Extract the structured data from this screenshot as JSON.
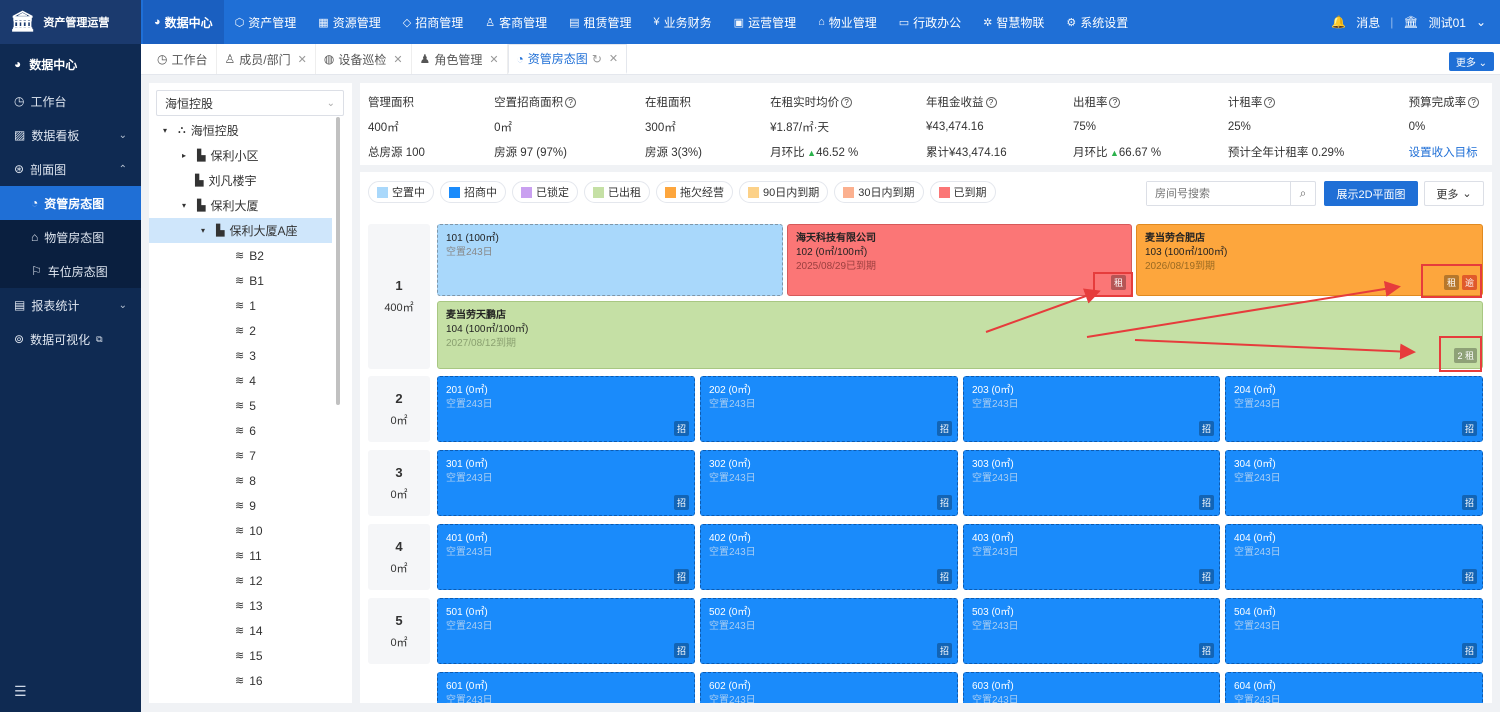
{
  "app": {
    "title": "资产管理运营"
  },
  "nav": [
    {
      "label": "数据中心",
      "icon": "pie-chart-icon",
      "glyph": "◕",
      "active": true
    },
    {
      "label": "资产管理",
      "icon": "cube-icon",
      "glyph": "⬡"
    },
    {
      "label": "资源管理",
      "icon": "building-icon",
      "glyph": "▦"
    },
    {
      "label": "招商管理",
      "icon": "tag-icon",
      "glyph": "◇"
    },
    {
      "label": "客商管理",
      "icon": "users-icon",
      "glyph": "♙"
    },
    {
      "label": "租赁管理",
      "icon": "file-icon",
      "glyph": "▤"
    },
    {
      "label": "业务财务",
      "icon": "yen-icon",
      "glyph": "¥"
    },
    {
      "label": "运营管理",
      "icon": "monitor-icon",
      "glyph": "▣"
    },
    {
      "label": "物业管理",
      "icon": "home-icon",
      "glyph": "⌂"
    },
    {
      "label": "行政办公",
      "icon": "desk-icon",
      "glyph": "▭"
    },
    {
      "label": "智慧物联",
      "icon": "iot-icon",
      "glyph": "✲"
    },
    {
      "label": "系统设置",
      "icon": "gear-icon",
      "glyph": "⚙"
    }
  ],
  "header_right": {
    "messages": "消息",
    "user": "测试01"
  },
  "sidebar": {
    "head": "数据中心",
    "items": [
      {
        "label": "工作台"
      },
      {
        "label": "数据看板"
      },
      {
        "label": "剖面图"
      },
      {
        "label": "报表统计"
      },
      {
        "label": "数据可视化"
      }
    ],
    "subitems": [
      {
        "label": "资管房态图"
      },
      {
        "label": "物管房态图"
      },
      {
        "label": "车位房态图"
      }
    ]
  },
  "tabs": [
    {
      "label": "工作台"
    },
    {
      "label": "成员/部门"
    },
    {
      "label": "设备巡检"
    },
    {
      "label": "角色管理"
    },
    {
      "label": "资管房态图"
    }
  ],
  "tabs_more": "更多",
  "tree": {
    "selector": "海恒控股",
    "nodes": [
      "海恒控股",
      "保利小区",
      "刘凡楼宇",
      "保利大厦",
      "保利大厦A座",
      "B2",
      "B1",
      "1",
      "2",
      "3",
      "4",
      "5",
      "6",
      "7",
      "8",
      "9",
      "10",
      "11",
      "12",
      "13",
      "14",
      "15",
      "16"
    ]
  },
  "stats": {
    "headers": [
      "管理面积",
      "空置招商面积",
      "在租面积",
      "在租实时均价",
      "年租金收益",
      "出租率",
      "计租率",
      "预算完成率"
    ],
    "values": [
      "400㎡",
      "0㎡",
      "300㎡",
      "¥1.87/㎡·天",
      "¥43,474.16",
      "75%",
      "25%",
      "0%"
    ],
    "row3": [
      "总房源 100",
      "房源 97 (97%)",
      "房源 3(3%)",
      "月环比",
      "累计¥43,474.16",
      "月环比",
      "预计全年计租率 0.29%",
      "设置收入目标"
    ],
    "mom1": "46.52 %",
    "mom2": "66.67 %"
  },
  "legend": [
    {
      "label": "空置中",
      "color": "#a9d8fb"
    },
    {
      "label": "招商中",
      "color": "#1a8bfb"
    },
    {
      "label": "已锁定",
      "color": "#c9a0f0"
    },
    {
      "label": "已出租",
      "color": "#c5e0a5"
    },
    {
      "label": "拖欠经营",
      "color": "#fda63d"
    },
    {
      "label": "90日内到期",
      "color": "#fcd188"
    },
    {
      "label": "30日内到期",
      "color": "#fbb08f"
    },
    {
      "label": "已到期",
      "color": "#fb7676"
    }
  ],
  "toolbar": {
    "search_placeholder": "房间号搜索",
    "show2d": "展示2D平面图",
    "more": "更多"
  },
  "floors": [
    {
      "num": "1",
      "area": "400㎡"
    },
    {
      "num": "2",
      "area": "0㎡"
    },
    {
      "num": "3",
      "area": "0㎡"
    },
    {
      "num": "4",
      "area": "0㎡"
    },
    {
      "num": "5",
      "area": "0㎡"
    }
  ],
  "rooms": {
    "r101": {
      "name": "101 (100㎡)",
      "status": "空置243日"
    },
    "r102": {
      "tenant": "海天科技有限公司",
      "name": "102 (0㎡/100㎡)",
      "status": "2025/08/29已到期",
      "badge": "租"
    },
    "r103": {
      "tenant": "麦当劳合肥店",
      "name": "103 (100㎡/100㎡)",
      "status": "2026/08/19到期",
      "badge1": "租",
      "badge2": "逾"
    },
    "r104": {
      "tenant": "麦当劳天鹏店",
      "name": "104 (100㎡/100㎡)",
      "status": "2027/08/12到期",
      "badge": "2 租"
    },
    "grid": [
      [
        "201 (0㎡)",
        "202 (0㎡)",
        "203 (0㎡)",
        "204 (0㎡)"
      ],
      [
        "301 (0㎡)",
        "302 (0㎡)",
        "303 (0㎡)",
        "304 (0㎡)"
      ],
      [
        "401 (0㎡)",
        "402 (0㎡)",
        "403 (0㎡)",
        "404 (0㎡)"
      ],
      [
        "501 (0㎡)",
        "502 (0㎡)",
        "503 (0㎡)",
        "504 (0㎡)"
      ],
      [
        "601 (0㎡)",
        "602 (0㎡)",
        "603 (0㎡)",
        "604 (0㎡)"
      ]
    ],
    "vacant_status": "空置243日",
    "invest_badge": "招"
  }
}
